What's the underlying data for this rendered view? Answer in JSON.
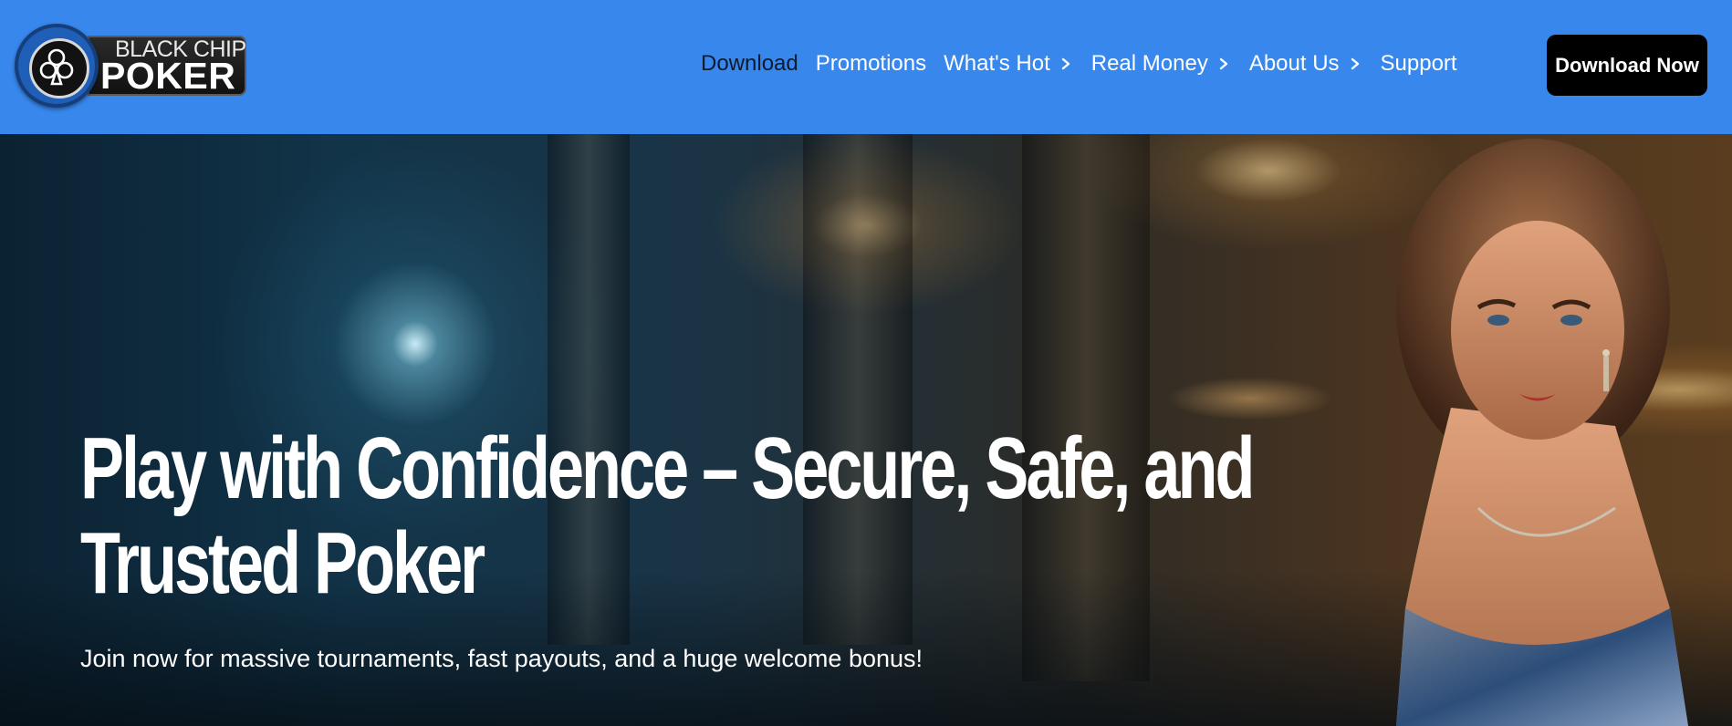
{
  "brand": {
    "logo_line1": "BLACK CHIP",
    "logo_line2": "POKER"
  },
  "nav": {
    "items": [
      {
        "label": "Download",
        "has_chevron": false,
        "active": true
      },
      {
        "label": "Promotions",
        "has_chevron": false
      },
      {
        "label": "What's Hot",
        "has_chevron": true
      },
      {
        "label": "Real Money",
        "has_chevron": true
      },
      {
        "label": "About Us",
        "has_chevron": true
      },
      {
        "label": "Support",
        "has_chevron": false
      }
    ],
    "cta_label": "Download Now"
  },
  "hero": {
    "headline_line1": "Play with Confidence – Secure, Safe, and",
    "headline_line2": "Trusted Poker",
    "subheadline": "Join now for massive tournaments, fast payouts, and a huge welcome bonus!"
  },
  "colors": {
    "header_bg": "#3787ec",
    "cta_bg": "#000000",
    "active_nav_text": "#0d1b2e",
    "text": "#ffffff"
  },
  "icons": {
    "logo_mark": "club-chip-icon",
    "nav_submenu": "chevron-right-icon"
  }
}
